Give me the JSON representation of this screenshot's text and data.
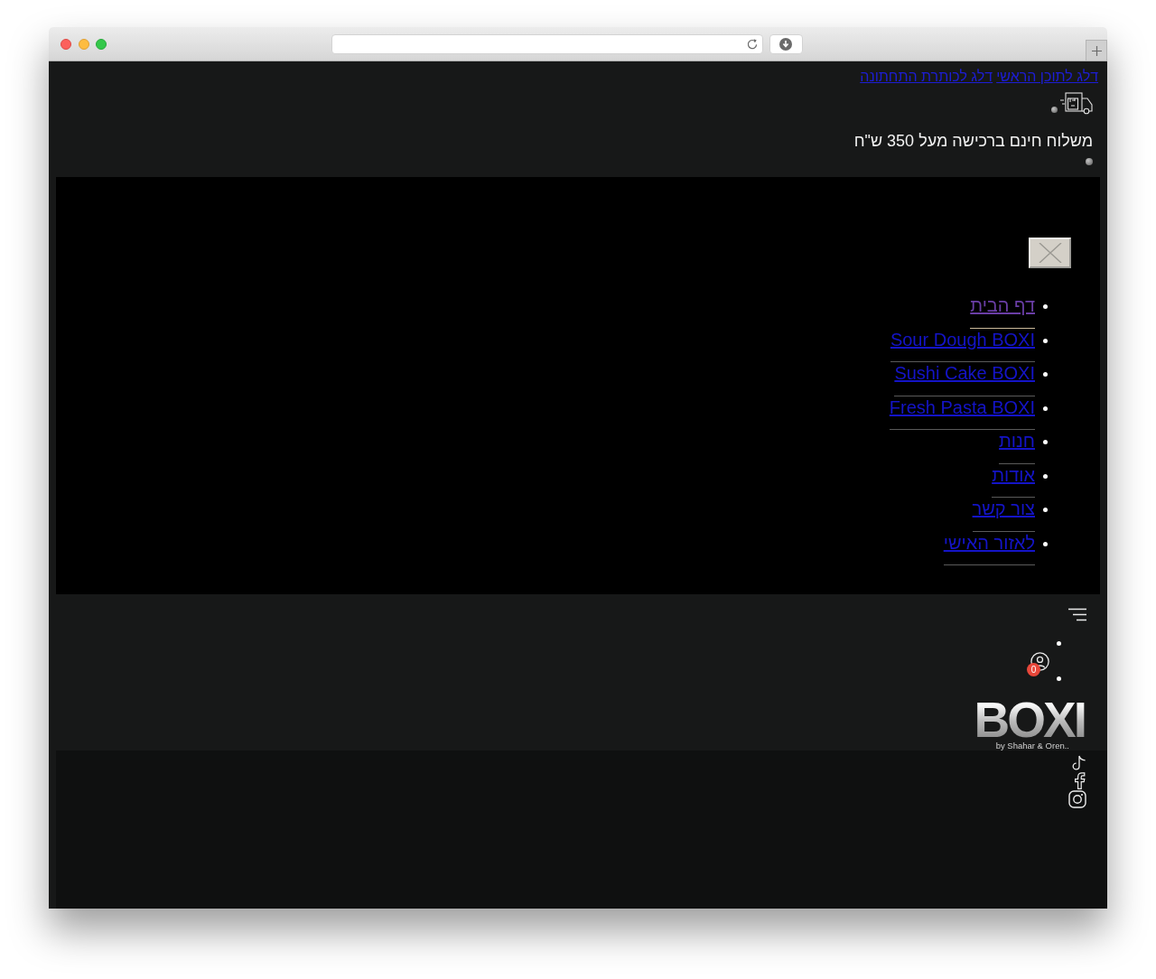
{
  "skip_links": [
    {
      "label": "דלג לתוכן הראשי"
    },
    {
      "label": "דלג לכותרת התחתונה"
    }
  ],
  "shipping_banner": {
    "text": "משלוח חינם ברכישה מעל 350 ש\"ח"
  },
  "menu": {
    "items": [
      {
        "label": "דף הבית",
        "selected": true
      },
      {
        "label": "Sour Dough BOXI",
        "selected": false
      },
      {
        "label": "Sushi Cake BOXI",
        "selected": false
      },
      {
        "label": "Fresh Pasta BOXI",
        "selected": false
      },
      {
        "label": "חנות",
        "selected": false
      },
      {
        "label": "אודות",
        "selected": false
      },
      {
        "label": "צור קשר",
        "selected": false
      },
      {
        "label": "לאזור האישי",
        "selected": false
      }
    ]
  },
  "header": {
    "cart_badge": "0",
    "logo": {
      "wordmark": "BOXI",
      "tagline": "by Shahar & Oren.."
    }
  }
}
